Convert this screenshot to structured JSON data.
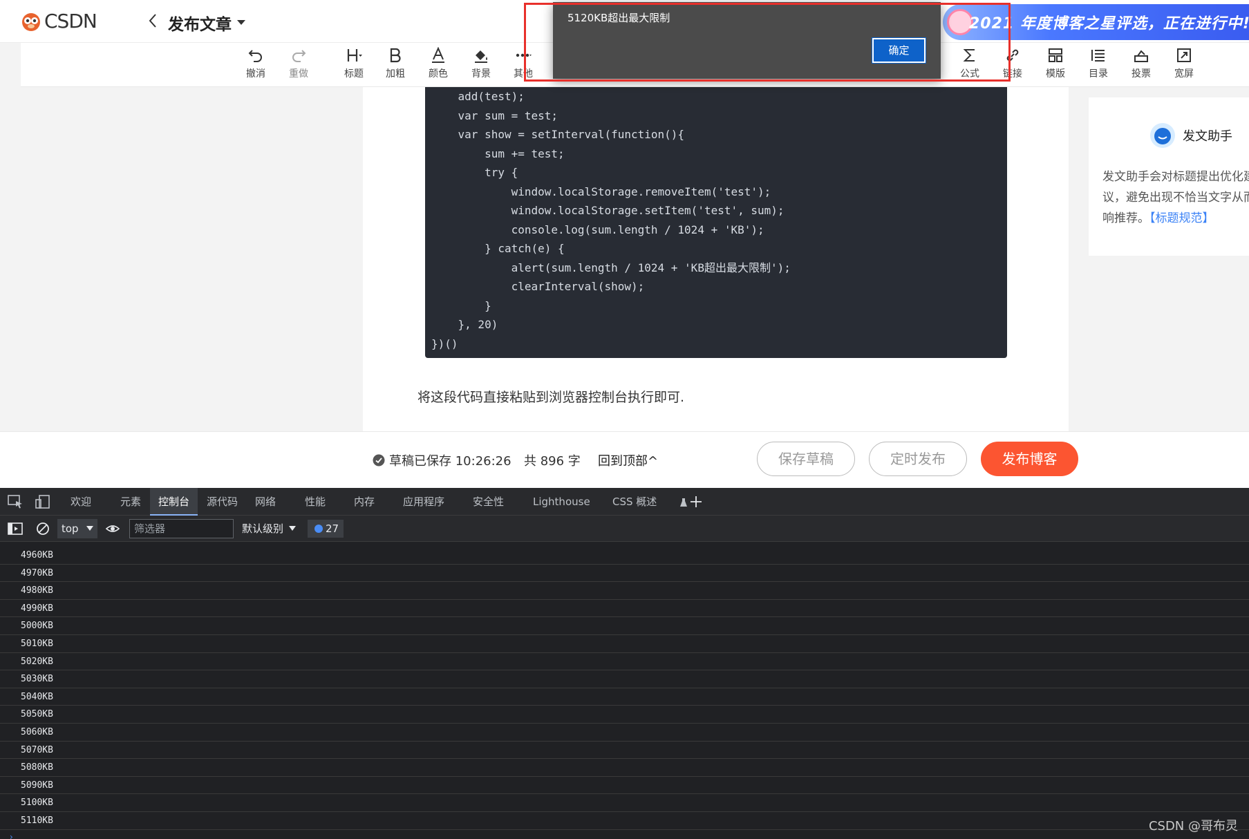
{
  "header": {
    "logo_text": "CSDN",
    "page_title": "发布文章",
    "banner_text": "2021 年度博客之星评选，正在进行中!"
  },
  "toolbar": {
    "items": [
      {
        "label": "撤消",
        "icon": "undo-icon"
      },
      {
        "label": "重做",
        "icon": "redo-icon"
      },
      {
        "label": "标题",
        "icon": "heading-icon"
      },
      {
        "label": "加粗",
        "icon": "bold-icon"
      },
      {
        "label": "颜色",
        "icon": "text-color-icon"
      },
      {
        "label": "背景",
        "icon": "background-fill-icon"
      },
      {
        "label": "其他",
        "icon": "more-dots-icon"
      },
      {
        "label": "公式",
        "icon": "sigma-icon"
      },
      {
        "label": "链接",
        "icon": "link-icon"
      },
      {
        "label": "模版",
        "icon": "template-icon"
      },
      {
        "label": "目录",
        "icon": "toc-icon"
      },
      {
        "label": "投票",
        "icon": "vote-icon"
      },
      {
        "label": "宽屏",
        "icon": "widescreen-icon"
      }
    ]
  },
  "editor": {
    "code_lines": [
      "    add(test);",
      "    var sum = test;",
      "    var show = setInterval(function(){",
      "        sum += test;",
      "        try {",
      "            window.localStorage.removeItem('test');",
      "            window.localStorage.setItem('test', sum);",
      "            console.log(sum.length / 1024 + 'KB');",
      "        } catch(e) {",
      "            alert(sum.length / 1024 + 'KB超出最大限制');",
      "            clearInterval(show);",
      "        }",
      "    }, 20)",
      "})()"
    ],
    "paragraph": "将这段代码直接粘贴到浏览器控制台执行即可."
  },
  "assistant": {
    "title": "发文助手",
    "description": "发文助手会对标题提出优化建议，避免出现不恰当文字从而影响推荐。",
    "link_text": "【标题规范】"
  },
  "footer": {
    "saved_status": "草稿已保存 10:26:26",
    "word_count": "共 896 字",
    "back_to_top": "回到顶部^",
    "save_draft": "保存草稿",
    "schedule_publish": "定时发布",
    "publish": "发布博客"
  },
  "devtools": {
    "tabs": [
      "欢迎",
      "元素",
      "控制台",
      "源代码",
      "网络",
      "性能",
      "内存",
      "应用程序",
      "安全性",
      "Lighthouse",
      "CSS 概述"
    ],
    "active_tab": "控制台",
    "context": "top",
    "filter_placeholder": "筛选器",
    "level": "默认级别",
    "message_count": "27",
    "log_lines": [
      "4960KB",
      "4970KB",
      "4980KB",
      "4990KB",
      "5000KB",
      "5010KB",
      "5020KB",
      "5030KB",
      "5040KB",
      "5050KB",
      "5060KB",
      "5070KB",
      "5080KB",
      "5090KB",
      "5100KB",
      "5110KB"
    ]
  },
  "alert": {
    "message": "5120KB超出最大限制",
    "ok_label": "确定"
  },
  "watermark": "CSDN @哥布灵",
  "colors": {
    "brand_red": "#fc5531",
    "link_blue": "#3b82f6",
    "devtools_bg": "#202124",
    "highlight_red": "#e8302b"
  }
}
